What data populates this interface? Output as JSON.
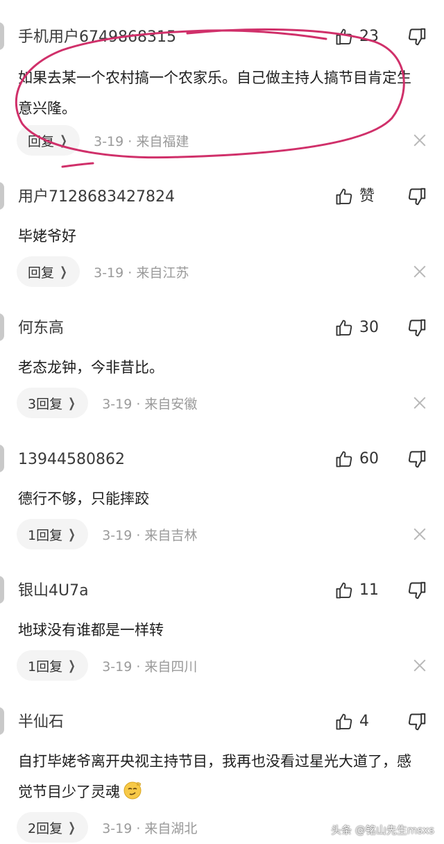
{
  "comments": [
    {
      "username": "手机用户6749868315",
      "likes": "23",
      "text": "如果去某一个农村搞一个农家乐。自己做主持人搞节目肯定生意兴隆。",
      "reply_label": "回复",
      "meta": "3-19 · 来自福建"
    },
    {
      "username": "用户7128683427824",
      "likes": "赞",
      "text": "毕姥爷好",
      "reply_label": "回复",
      "meta": "3-19 · 来自江苏"
    },
    {
      "username": "何东高",
      "likes": "30",
      "text": "老态龙钟，今非昔比。",
      "reply_label": "3回复",
      "meta": "3-19 · 来自安徽"
    },
    {
      "username": "13944580862",
      "likes": "60",
      "text": "德行不够，只能摔跤",
      "reply_label": "1回复",
      "meta": "3-19 · 来自吉林"
    },
    {
      "username": "银山4U7a",
      "likes": "11",
      "text": "地球没有谁都是一样转",
      "reply_label": "1回复",
      "meta": "3-19 · 来自四川"
    },
    {
      "username": "半仙石",
      "likes": "4",
      "text": "自打毕姥爷离开央视主持节目，我再也没看过星光大道了，感觉节目少了灵魂",
      "reply_label": "2回复",
      "meta": "3-19 · 来自湖北"
    }
  ],
  "watermark": "头条 @铭山先生msxs",
  "colors": {
    "annotation_circle": "#d0306a",
    "meta_gray": "#9a9a9a",
    "reply_bg": "#f4f4f4"
  }
}
